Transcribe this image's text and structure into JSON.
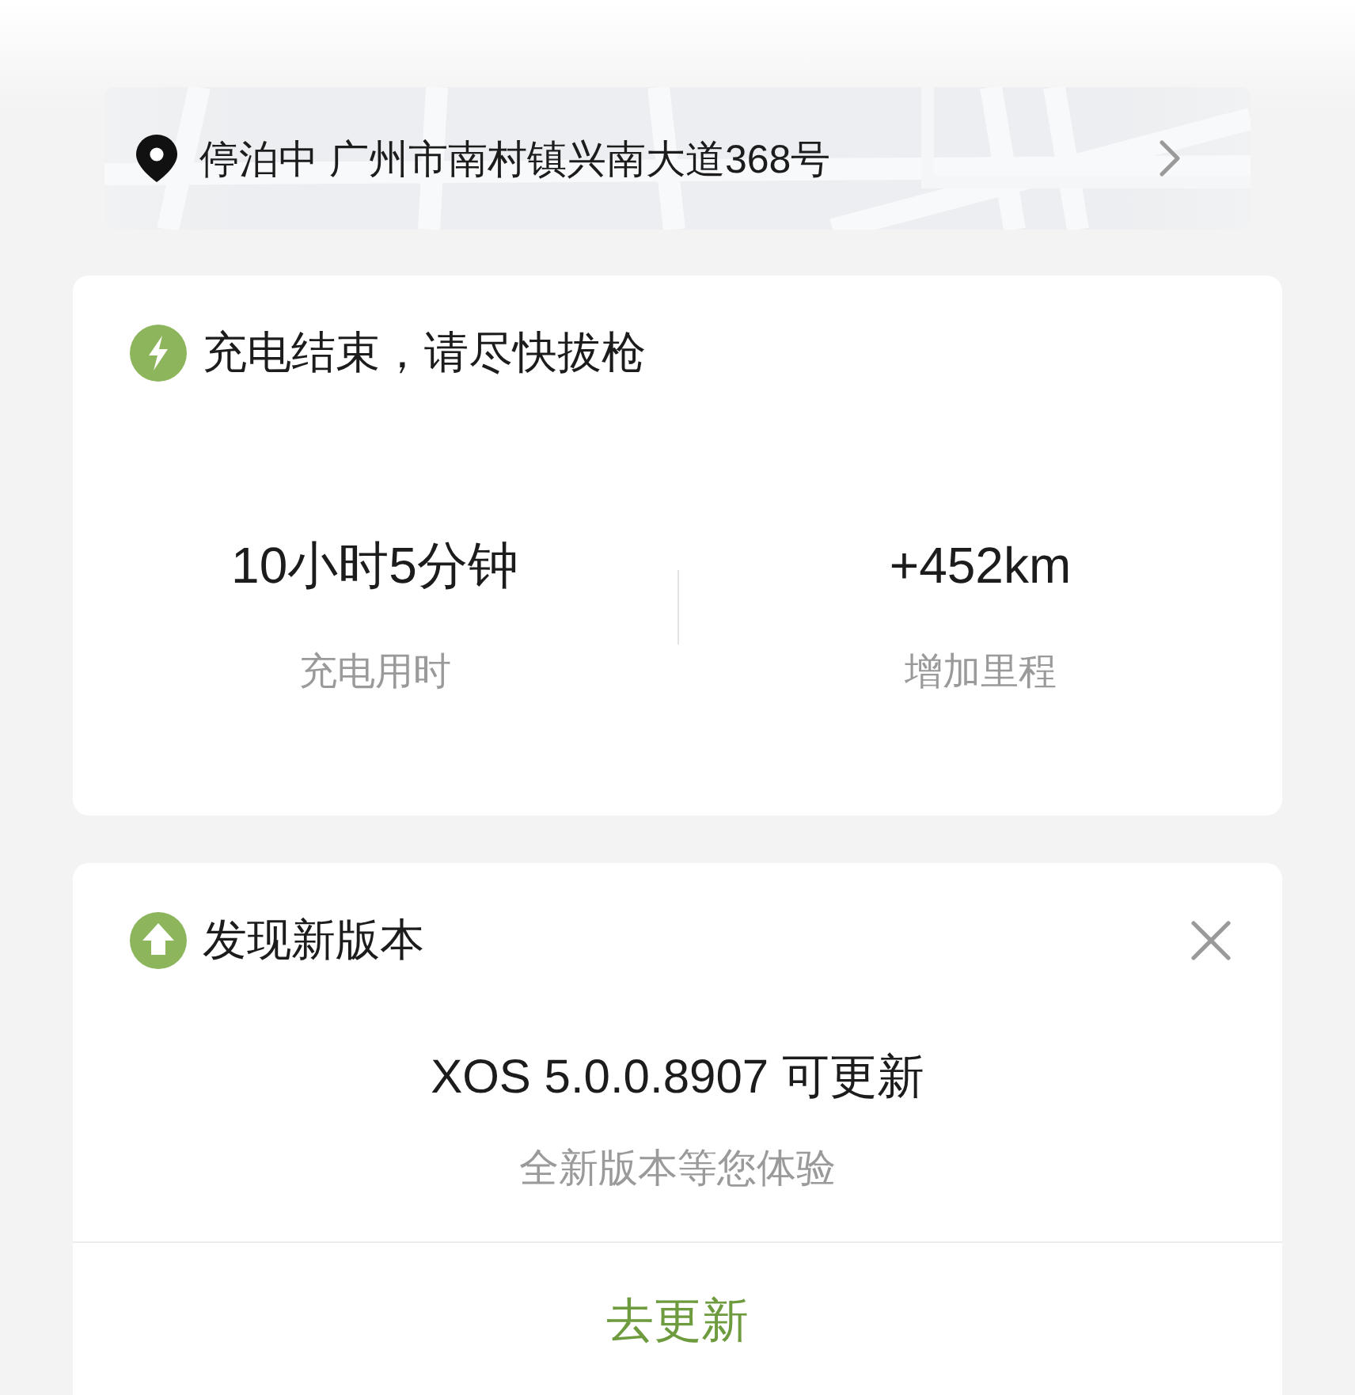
{
  "location": {
    "text": "停泊中 广州市南村镇兴南大道368号"
  },
  "charging_card": {
    "title": "充电结束，请尽快拔枪",
    "stats": [
      {
        "value": "10小时5分钟",
        "label": "充电用时"
      },
      {
        "value": "+452km",
        "label": "增加里程"
      }
    ]
  },
  "update_card": {
    "title": "发现新版本",
    "version": "XOS 5.0.0.8907 可更新",
    "subtitle": "全新版本等您体验",
    "action": "去更新"
  }
}
